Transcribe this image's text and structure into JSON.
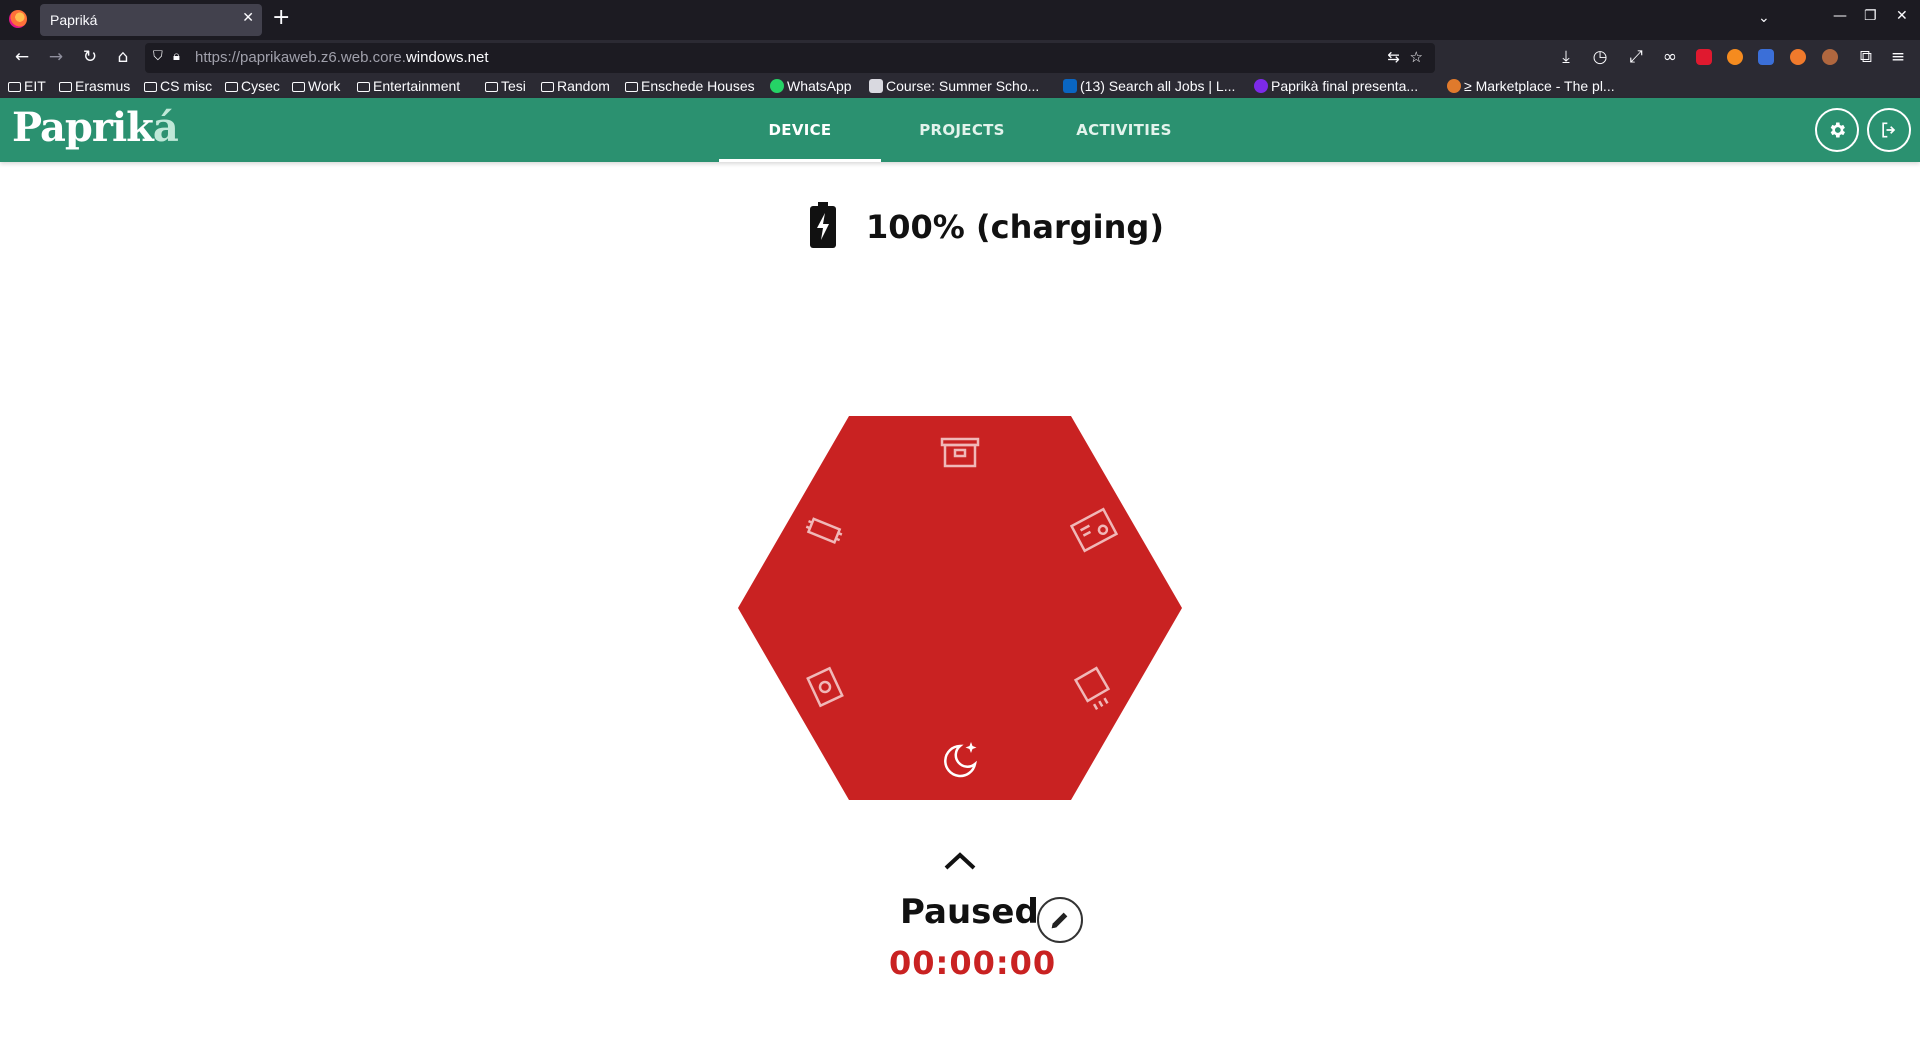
{
  "browser": {
    "tab_title": "Papriká",
    "tab_close": "✕",
    "new_tab": "+",
    "url_prefix": "https://paprikaweb.z6.web.core.",
    "url_domain": "windows.net",
    "bookmarks": [
      {
        "label": "EIT",
        "icon": "folder-icon"
      },
      {
        "label": "Erasmus",
        "icon": "folder-icon"
      },
      {
        "label": "CS misc",
        "icon": "folder-icon"
      },
      {
        "label": "Cysec",
        "icon": "folder-icon"
      },
      {
        "label": "Work",
        "icon": "folder-icon"
      },
      {
        "label": "Entertainment",
        "icon": "folder-icon"
      },
      {
        "label": "Tesi",
        "icon": "folder-icon"
      },
      {
        "label": "Random",
        "icon": "folder-icon"
      },
      {
        "label": "Enschede Houses",
        "icon": "folder-icon"
      },
      {
        "label": "WhatsApp",
        "icon": "whatsapp-icon"
      },
      {
        "label": "Course: Summer Scho...",
        "icon": "course-site-icon"
      },
      {
        "label": "(13) Search all Jobs | L...",
        "icon": "linkedin-icon"
      },
      {
        "label": "Paprikà final presenta...",
        "icon": "canva-icon"
      },
      {
        "label": "≥ Marketplace - The pl...",
        "icon": "marketplace-icon"
      }
    ],
    "colors": {
      "chrome_dark": "#1c1b22",
      "chrome": "#2b2a33"
    }
  },
  "app": {
    "logo_main": "Paprik",
    "logo_accent": "á",
    "tabs": [
      {
        "label": "DEVICE",
        "active": true
      },
      {
        "label": "PROJECTS",
        "active": false
      },
      {
        "label": "ACTIVITIES",
        "active": false
      }
    ],
    "header_buttons": [
      "settings-icon",
      "logout-icon"
    ],
    "colors": {
      "primary": "#2b9170",
      "hexagon": "#c92222",
      "timer": "#c92222"
    }
  },
  "device": {
    "battery_icon": "battery-charging-icon",
    "battery_text": "100% (charging)",
    "hex_faces": [
      "archive-box-icon",
      "ticket-icon",
      "postcard-icon",
      "moon-stars-icon",
      "coupon-icon",
      "eraser-icon"
    ],
    "chevron": "chevron-up-icon",
    "status": "Paused",
    "edit_icon": "pencil-icon",
    "timer": "00:00:00"
  }
}
